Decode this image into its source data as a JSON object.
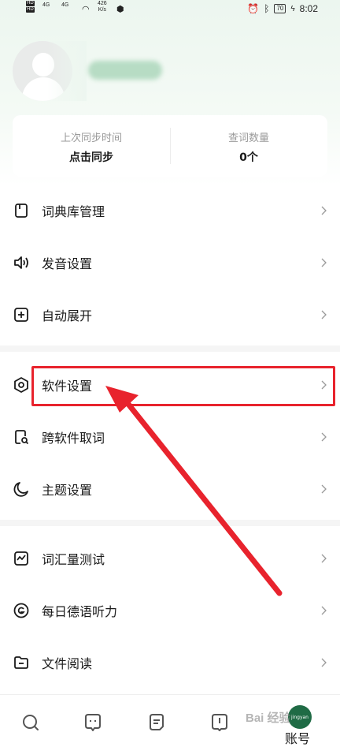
{
  "status_bar": {
    "hd_top": "HD",
    "hd_bottom": "HD",
    "signal1": "4G",
    "signal2": "4G",
    "speed_value": "426",
    "speed_unit": "K/s",
    "battery": "70",
    "time": "8:02"
  },
  "stats": {
    "sync_label": "上次同步时间",
    "sync_value": "点击同步",
    "lookup_label": "查词数量",
    "lookup_value": "0个"
  },
  "menu": {
    "group1": [
      {
        "label": "词典库管理",
        "icon": "bookmark-icon"
      },
      {
        "label": "发音设置",
        "icon": "speaker-icon"
      },
      {
        "label": "自动展开",
        "icon": "plus-box-icon"
      }
    ],
    "group2": [
      {
        "label": "软件设置",
        "icon": "hexagon-settings-icon"
      },
      {
        "label": "跨软件取词",
        "icon": "search-doc-icon"
      },
      {
        "label": "主题设置",
        "icon": "moon-icon"
      }
    ],
    "group3": [
      {
        "label": "词汇量测试",
        "icon": "chart-box-icon"
      },
      {
        "label": "每日德语听力",
        "icon": "listen-circle-icon"
      },
      {
        "label": "文件阅读",
        "icon": "folder-icon"
      }
    ]
  },
  "bottom_nav": {
    "account_label": "账号",
    "account_badge": "jingyan"
  },
  "watermark": "Bai 经验",
  "colors": {
    "highlight": "#e8232d",
    "brand_green": "#1f6b45"
  }
}
